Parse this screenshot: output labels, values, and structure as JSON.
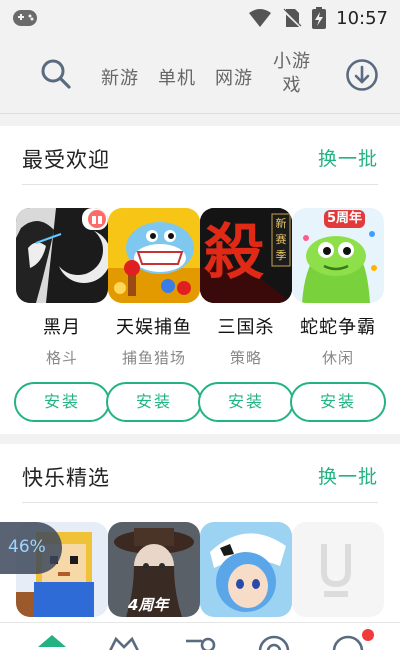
{
  "status_bar": {
    "time": "10:57"
  },
  "nav": {
    "tabs": [
      "新游",
      "单机",
      "网游"
    ],
    "tab_mini_line1": "小游",
    "tab_mini_line2": "戏"
  },
  "sections": [
    {
      "title": "最受欢迎",
      "refresh_label": "换一批",
      "games": [
        {
          "name": "黑月",
          "category": "格斗",
          "install_label": "安装"
        },
        {
          "name": "天娱捕鱼",
          "category": "捕鱼猎场",
          "install_label": "安装"
        },
        {
          "name": "三国杀",
          "category": "策略",
          "install_label": "安装"
        },
        {
          "name": "蛇蛇争霸",
          "category": "休闲",
          "install_label": "安装"
        }
      ]
    },
    {
      "title": "快乐精选",
      "refresh_label": "换一批"
    }
  ],
  "icon_text": {
    "sanguosha_big": "殺",
    "sanguosha_side": "新赛季",
    "snake_badge": "5周年",
    "anniv_badge": "4周年"
  },
  "float_progress": {
    "label": "46%",
    "value": 0.46
  },
  "colors": {
    "accent": "#23b383",
    "badge": "#f23a3a"
  }
}
